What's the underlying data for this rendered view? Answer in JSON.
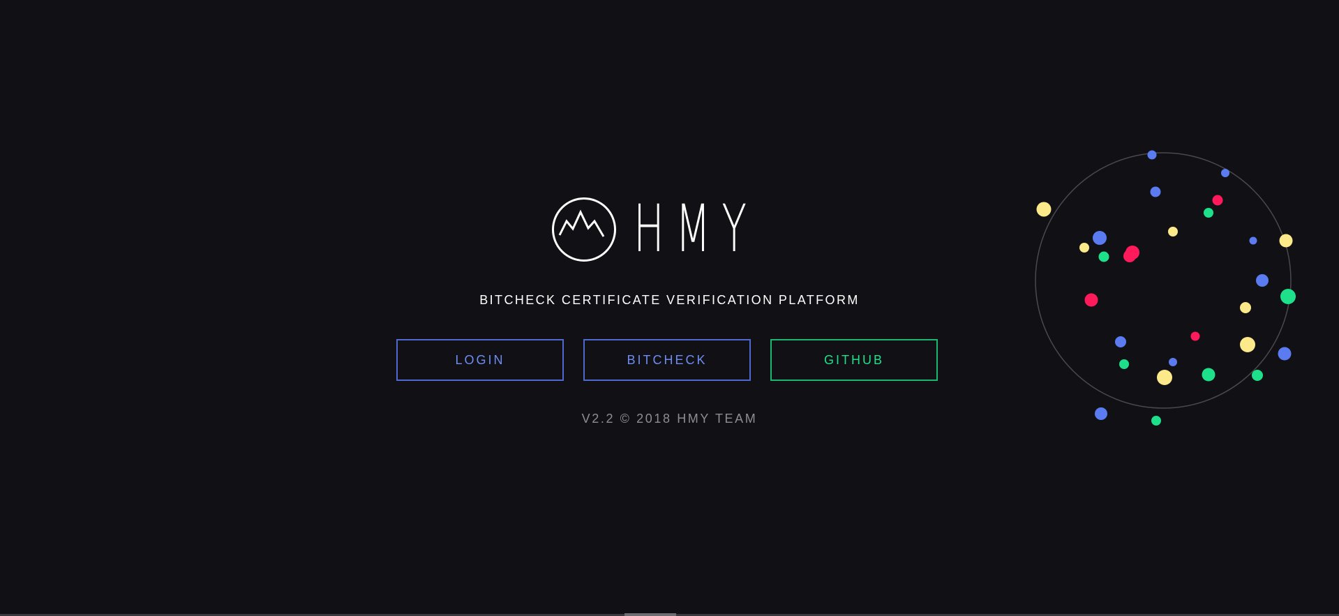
{
  "brand": {
    "name": "HMY",
    "logo_icon": "mountain-circle-icon"
  },
  "tagline": "BITCHECK CERTIFICATE VERIFICATION PLATFORM",
  "buttons": {
    "login": "LOGIN",
    "bitcheck": "BITCHECK",
    "github": "GITHUB"
  },
  "footer": {
    "version": "V2.2 © 2018 HMY TEAM"
  },
  "colors": {
    "background": "#111115",
    "accent_blue": "#5b7cf0",
    "accent_green": "#1ee08a",
    "accent_yellow": "#fbe98a",
    "accent_pink": "#ff1a5c"
  }
}
